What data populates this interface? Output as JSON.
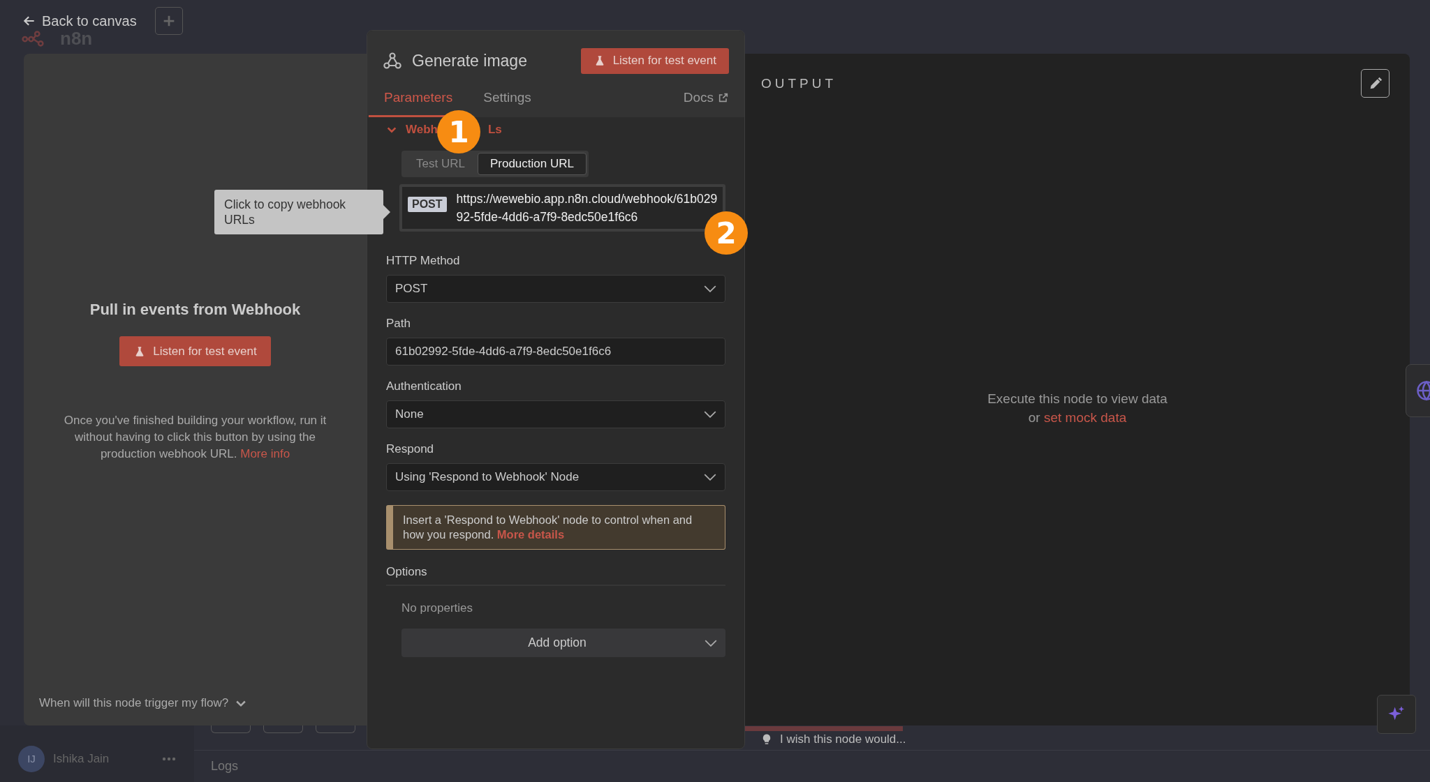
{
  "top_bar": {
    "back_label": "Back to canvas",
    "logo_text": "n8n"
  },
  "input_panel": {
    "title": "Pull in events from Webhook",
    "button": "Listen for test event",
    "hint": "Once you've finished building your workflow, run it without having to click this button by using the production webhook URL.",
    "hint_link": "More info",
    "trigger_question": "When will this node trigger my flow?"
  },
  "node": {
    "title": "Generate image",
    "listen_button": "Listen for test event",
    "docs_link": "Docs",
    "tabs": [
      {
        "label": "Parameters",
        "selected": true
      },
      {
        "label": "Settings",
        "selected": false
      }
    ],
    "webhook_section": {
      "label_start": "Webh",
      "label_end": "Ls",
      "expanded": true
    },
    "url_toggle": [
      {
        "label": "Test URL",
        "selected": false
      },
      {
        "label": "Production URL",
        "selected": true
      }
    ],
    "url": {
      "method": "POST",
      "address": "https://wewebio.app.n8n.cloud/webhook/61b02992-5fde-4dd6-a7f9-8edc50e1f6c6"
    },
    "tooltip": "Click to copy webhook URLs",
    "fields": [
      {
        "kind": "select",
        "label": "HTTP Method",
        "value": "POST"
      },
      {
        "kind": "text",
        "label": "Path",
        "value": "61b02992-5fde-4dd6-a7f9-8edc50e1f6c6"
      },
      {
        "kind": "select",
        "label": "Authentication",
        "value": "None"
      },
      {
        "kind": "select",
        "label": "Respond",
        "value": "Using 'Respond to Webhook' Node"
      }
    ],
    "notice": {
      "text": "Insert a 'Respond to Webhook' node to control when and how you respond.",
      "link": "More details"
    },
    "options": {
      "label": "Options",
      "empty": "No properties",
      "add_button": "Add option"
    }
  },
  "output": {
    "title": "OUTPUT",
    "message": "Execute this node to view data",
    "or": "or",
    "link": "set mock data"
  },
  "feedback": "I wish this node would...",
  "user": {
    "initials": "IJ",
    "name": "Ishika Jain"
  },
  "logs": "Logs",
  "annotations": [
    {
      "label": "1"
    },
    {
      "label": "2"
    }
  ]
}
